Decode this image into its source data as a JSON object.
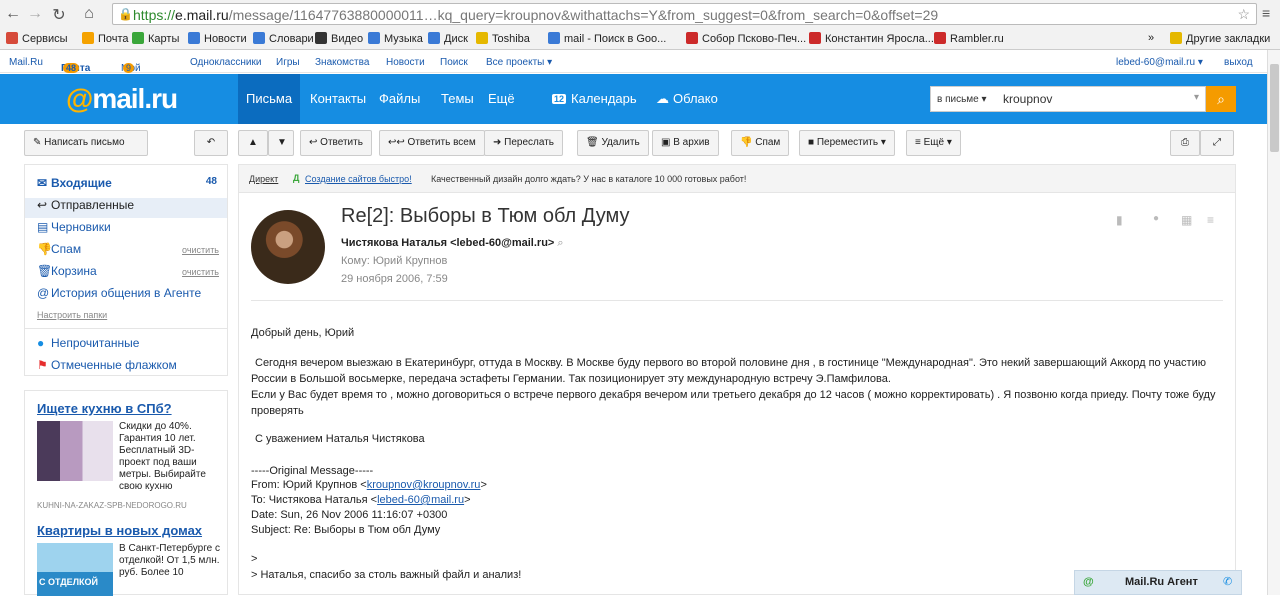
{
  "browser": {
    "url_proto": "https://",
    "url_host": "e.mail.ru",
    "url_path": "/message/11647763880000011",
    "url_tail": "kq_query=kroupnov&withattachs=Y&from_suggest=0&from_search=0&offset=29",
    "bookmarks": [
      {
        "label": "Сервисы",
        "color": "#d64a3a"
      },
      {
        "label": "Почта",
        "color": "#f5a200"
      },
      {
        "label": "Карты",
        "color": "#3aa63a"
      },
      {
        "label": "Новости",
        "color": "#3a7ad6"
      },
      {
        "label": "Словари",
        "color": "#3a7ad6"
      },
      {
        "label": "Видео",
        "color": "#333333"
      },
      {
        "label": "Музыка",
        "color": "#3a7ad6"
      },
      {
        "label": "Диск",
        "color": "#3a7ad6"
      },
      {
        "label": "Toshiba",
        "color": "#e5b800"
      },
      {
        "label": "mail - Поиск в Goo...",
        "color": "#3a7ad6"
      },
      {
        "label": "Собор Псково-Печ...",
        "color": "#cc2a2a"
      },
      {
        "label": "Константин Яросла...",
        "color": "#cc2a2a"
      },
      {
        "label": "Rambler.ru",
        "color": "#cc2a2a"
      }
    ],
    "bookmarks_more": "»",
    "other_bookmarks": "Другие закладки"
  },
  "portal": {
    "mailru": "Mail.Ru",
    "mail": "Почта",
    "mail_count": "48",
    "myworld": "Мой Мир",
    "myworld_count": "9",
    "ok": "Одноклассники",
    "games": "Игры",
    "dating": "Знакомства",
    "news": "Новости",
    "search": "Поиск",
    "allprojects": "Все проекты ▾",
    "user": "lebed-60@mail.ru ▾",
    "logout": "выход"
  },
  "header": {
    "logo_at": "@",
    "logo_text": "mail.ru",
    "tabs": [
      "Письма",
      "Контакты",
      "Файлы",
      "Темы",
      "Ещё"
    ],
    "calendar": "Календарь",
    "calendar_day": "12",
    "cloud": "Облако",
    "search_scope": "в письме ▾",
    "search_query": "kroupnov"
  },
  "toolbar": {
    "compose": "Написать письмо",
    "reply": "Ответить",
    "reply_all": "Ответить всем",
    "forward": "Переслать",
    "delete": "Удалить",
    "archive": "В архив",
    "spam": "Спам",
    "move": "Переместить ▾",
    "more": "≡ Ещё ▾"
  },
  "sidebar": {
    "items": [
      {
        "label": "Входящие",
        "count": "48"
      },
      {
        "label": "Отправленные"
      },
      {
        "label": "Черновики"
      },
      {
        "label": "Спам",
        "action": "очистить"
      },
      {
        "label": "Корзина",
        "action": "очистить"
      },
      {
        "label": "История общения в Агенте"
      }
    ],
    "setup": "Настроить папки",
    "unread": "Непрочитанные",
    "flagged": "Отмеченные флажком"
  },
  "ads": [
    {
      "title": "Ищете кухню в СПб?",
      "text": "Скидки до 40%. Гарантия 10 лет. Бесплатный 3D-проект под ваши метры. Выбирайте свою кухню",
      "domain": "KUHNI-NA-ZAKAZ-SPB-NEDOROGO.RU"
    },
    {
      "title": "Квартиры в новых домах",
      "text": "В Санкт-Петербурге с отделкой! От 1,5 млн. руб. Более 10",
      "badge": "С ОТДЕЛКОЙ"
    }
  ],
  "direct": {
    "label": "Директ",
    "link": "Создание сайтов быстро!",
    "text": "Качественный дизайн долго ждать? У нас в каталоге 10 000 готовых работ!"
  },
  "message": {
    "subject": "Re[2]: Выборы в Тюм обл Думу",
    "from": "Чистякова Наталья <lebed-60@mail.ru>",
    "to": "Кому: Юрий Крупнов",
    "date": "29 ноября 2006, 7:59",
    "greeting": "Добрый день, Юрий",
    "p1": "Сегодня вечером выезжаю в Екатеринбург, оттуда в Москву. В Москве буду первого во второй половине дня , в гостинице \"Международная\". Это некий завершающий Аккорд по участию России в Большой восьмерке, передача эстафеты Германии. Так позиционирует эту международную встречу Э.Памфилова.",
    "p2": "Если у Вас будет время то , можно договориться о встрече первого декабря вечером или третьего декабря до 12 часов ( можно корректировать) . Я позвоню когда приеду. Почту тоже буду проверять",
    "sign": "С уважением Наталья Чистякова",
    "orig": "-----Original Message-----",
    "orig_from_prefix": "From: Юрий Крупнов <",
    "orig_from_email": "kroupnov@kroupnov.ru",
    "orig_to_prefix": "To: Чистякова Наталья <",
    "orig_to_email": "lebed-60@mail.ru",
    "orig_date": "Date: Sun, 26 Nov 2006 11:16:07 +0300",
    "orig_subject": "Subject: Re: Выборы в Тюм обл Думу",
    "q0": ">",
    "q1": "> Наталья, спасибо за столь важный файл и анализ!"
  },
  "agent": {
    "label": "Mail.Ru Агент"
  }
}
